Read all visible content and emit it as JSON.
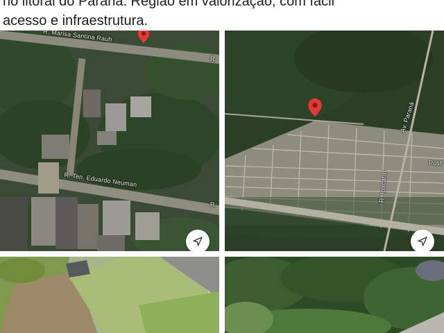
{
  "post": {
    "caption_line1": "no litoral do Paraná. Região em valorização, com fácil",
    "caption_line2": "acesso e infraestrutura."
  },
  "photos": [
    {
      "id": "street-map-satellite",
      "streets": [
        "R. Marisa Santina Rauh",
        "R.",
        "R. Ten. Eduardo Neuman",
        "R."
      ],
      "location_pin": "map-pin-icon",
      "action_icon": "navigation-arrow-icon"
    },
    {
      "id": "neighborhood-satellite",
      "streets": [
        "Av. Paraná",
        "R. Ipacaraí",
        "Post"
      ],
      "location_pin": "map-pin-icon",
      "action_icon": "navigation-arrow-icon"
    },
    {
      "id": "aerial-drone-lot"
    },
    {
      "id": "aerial-drone-trees"
    }
  ],
  "colors": {
    "forest": "#2a3f26",
    "pin": "#e53935",
    "text": "#1c1e21"
  }
}
